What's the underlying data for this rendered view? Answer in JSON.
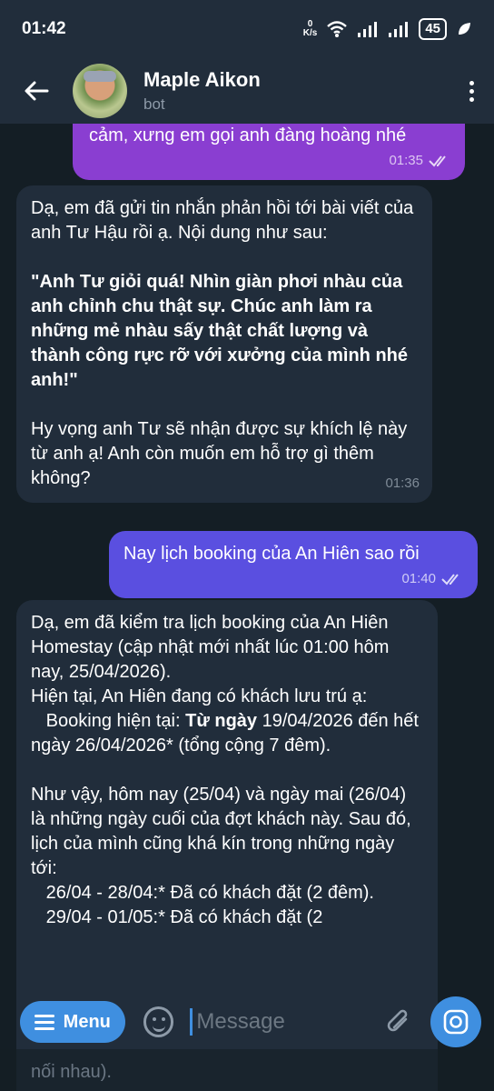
{
  "status_bar": {
    "time": "01:42",
    "net_speed_value": "0",
    "net_speed_unit": "K/s",
    "battery": "45"
  },
  "header": {
    "title": "Maple Aikon",
    "subtitle": "bot"
  },
  "messages": [
    {
      "direction": "outgoing",
      "text": "cảm, xưng em gọi anh đàng hoàng nhé",
      "time": "01:35"
    },
    {
      "direction": "incoming",
      "paragraphs": [
        "Dạ, em đã gửi tin nhắn phản hồi tới bài viết của anh Tư Hậu rồi ạ. Nội dung như sau:",
        "\"Anh Tư giỏi quá! Nhìn giàn phơi nhàu của anh chỉnh chu thật sự. Chúc anh làm ra những mẻ nhàu sấy thật chất lượng và thành công rực rỡ với xưởng của mình nhé anh!\"",
        "Hy vọng anh Tư sẽ nhận được sự khích lệ này từ anh ạ! Anh còn muốn em hỗ trợ gì thêm không?"
      ],
      "time": "01:36"
    },
    {
      "direction": "outgoing",
      "text": "Nay lịch booking của An Hiên sao rồi",
      "time": "01:40"
    },
    {
      "direction": "incoming",
      "p1": "Dạ, em đã kiểm tra lịch booking của An Hiên Homestay (cập nhật mới nhất lúc 01:00 hôm nay, 25/04/2026).",
      "p2_line1": "Hiện tại, An Hiên đang có khách lưu trú ạ:",
      "p2_indent": "   Booking hiện tại: ",
      "p2_bold": "Từ ngày",
      "p2_rest": " 19/04/2026 đến hết ngày 26/04/2026* (tổng cộng 7 đêm).",
      "p3": "Như vậy, hôm nay (25/04) và ngày mai (26/04) là những ngày cuối của đợt khách này. Sau đó, lịch của mình cũng khá kín trong những ngày tới:",
      "p3_item1": "   26/04 - 28/04:* Đã có khách đặt (2 đêm).",
      "p3_item2": "   29/04 - 01/05:* Đã có khách đặt (2",
      "p3_tail": "nối nhau)."
    }
  ],
  "input_bar": {
    "menu_label": "Menu",
    "placeholder": "Message"
  },
  "colors": {
    "accent": "#3f8fe0",
    "outgoing_purple": "#8a3ed1",
    "outgoing_blue": "#5a4fe0",
    "incoming": "#212d3b",
    "header": "#212d3b"
  }
}
